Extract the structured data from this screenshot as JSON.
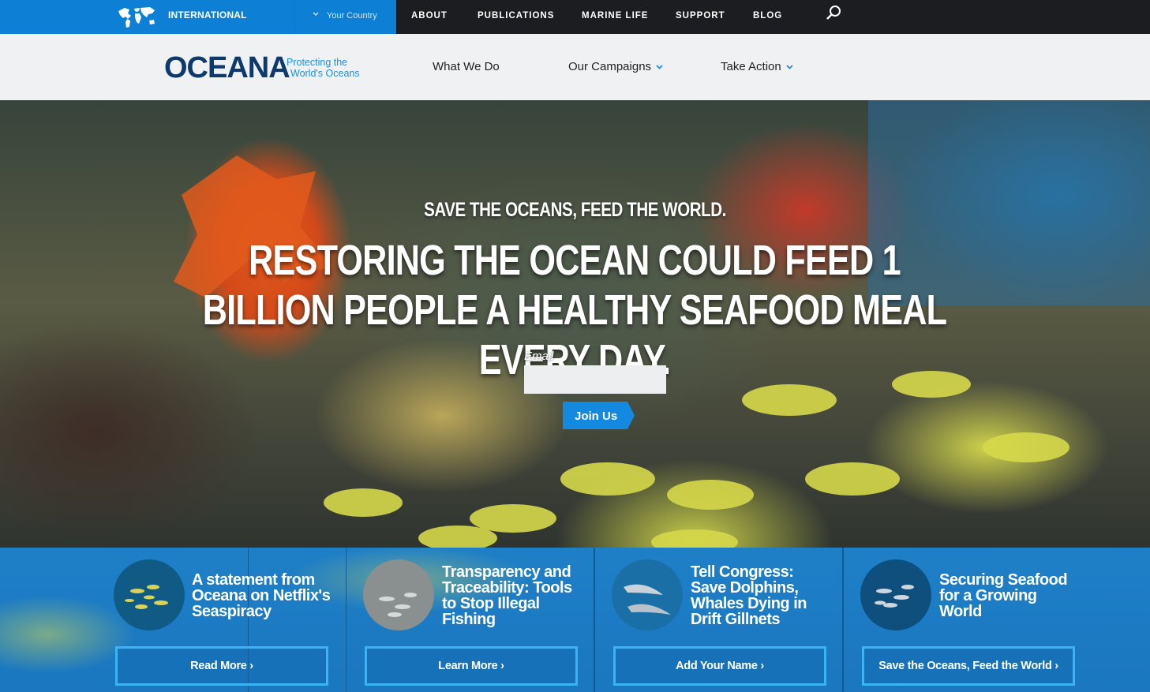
{
  "topbar": {
    "international_label": "INTERNATIONAL",
    "country_label": "Your Country",
    "nav": [
      "ABOUT",
      "PUBLICATIONS",
      "MARINE LIFE",
      "SUPPORT",
      "BLOG"
    ],
    "search_icon": "search-icon"
  },
  "header": {
    "logo": "OCEANA",
    "tagline_line1": "Protecting the",
    "tagline_line2": "World's Oceans",
    "nav": [
      "What We Do",
      "Our Campaigns",
      "Take Action"
    ]
  },
  "hero": {
    "kicker": "SAVE THE OCEANS, FEED THE WORLD.",
    "title": "RESTORING THE OCEAN COULD FEED 1 BILLION PEOPLE A HEALTHY SEAFOOD MEAL EVERY DAY.",
    "email_label": "Email",
    "email_value": "",
    "join_label": "Join Us"
  },
  "cards": [
    {
      "title": "A statement from Oceana on Netflix's Seaspiracy",
      "button": "Read More"
    },
    {
      "title": "Transparency and Traceability: Tools to Stop Illegal Fishing",
      "button": "Learn More"
    },
    {
      "title": "Tell Congress: Save Dolphins, Whales Dying in Drift Gillnets",
      "button": "Add Your Name"
    },
    {
      "title": "Securing Seafood for a Growing World",
      "button": "Save the Oceans, Feed the World"
    }
  ],
  "colors": {
    "topbar_blue": "#0d7fd4",
    "topbar_dark": "#1c1d20",
    "logo_navy": "#0e3a6b",
    "accent_blue": "#1f8fd8",
    "card_border": "#3bb3f5"
  }
}
